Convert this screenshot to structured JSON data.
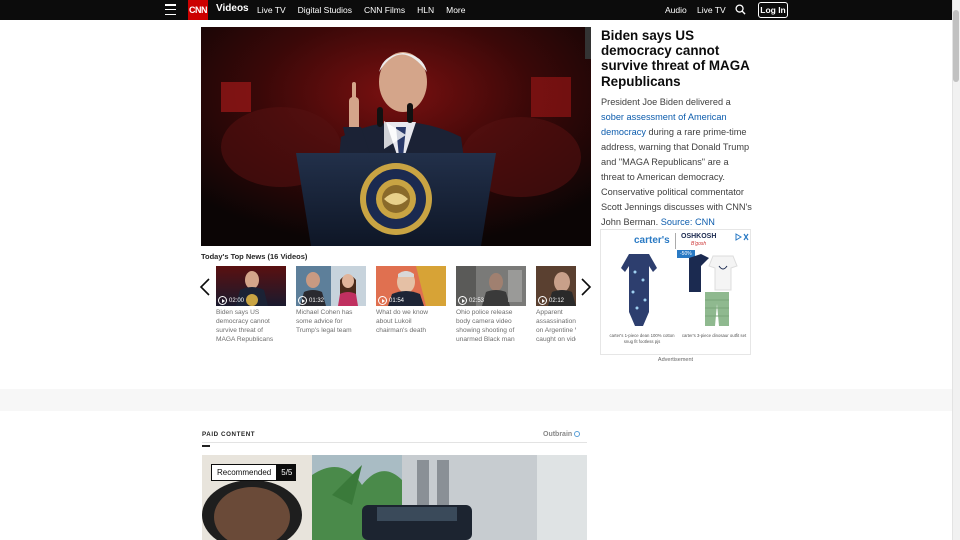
{
  "nav": {
    "logo": "CNN",
    "section": "Videos",
    "links": [
      "Live TV",
      "Digital Studios",
      "CNN Films",
      "HLN",
      "More"
    ],
    "audio": "Audio",
    "live_tv": "Live TV",
    "login": "Log In"
  },
  "article": {
    "headline": "Biden says US democracy cannot survive threat of MAGA Republicans",
    "desc_before": "President Joe Biden delivered a ",
    "desc_link": "sober assessment of American democracy",
    "desc_after": " during a rare prime-time address, warning that Donald Trump and \"MAGA Republicans\" are a threat to American democracy. Conservative political commentator Scott Jennings discusses with CNN's John Berman. ",
    "source": "Source: CNN"
  },
  "ad": {
    "brand1": "carter's",
    "brand2": "OSHKOSH",
    "brand2_sub": "B'gosh",
    "badge": "-50%",
    "caption1": "carter's 1-piece dean 100% cotton snug fit footless pjs",
    "caption2": "carter's 3-piece dinosaur outfit set",
    "label": "Advertisement"
  },
  "top_news": {
    "title": "Today's Top News (16 Videos)",
    "items": [
      {
        "duration": "02:00",
        "title": "Biden says US democracy cannot survive threat of MAGA Republicans"
      },
      {
        "duration": "01:32",
        "title": "Michael Cohen has some advice for Trump's legal team"
      },
      {
        "duration": "01:54",
        "title": "What do we know about Lukoil chairman's death"
      },
      {
        "duration": "02:53",
        "title": "Ohio police release body camera video showing shooting of unarmed Black man"
      },
      {
        "duration": "02:12",
        "title": "Apparent assassination attempt on Argentine VP caught on video"
      }
    ]
  },
  "paid": {
    "label": "PAID CONTENT",
    "provider": "Outbrain",
    "recommended": "Recommended",
    "count": "5/5"
  },
  "colors": {
    "brand_red": "#cc0000",
    "link_blue": "#0c5cad",
    "nav_bg": "#0c0c0c"
  }
}
